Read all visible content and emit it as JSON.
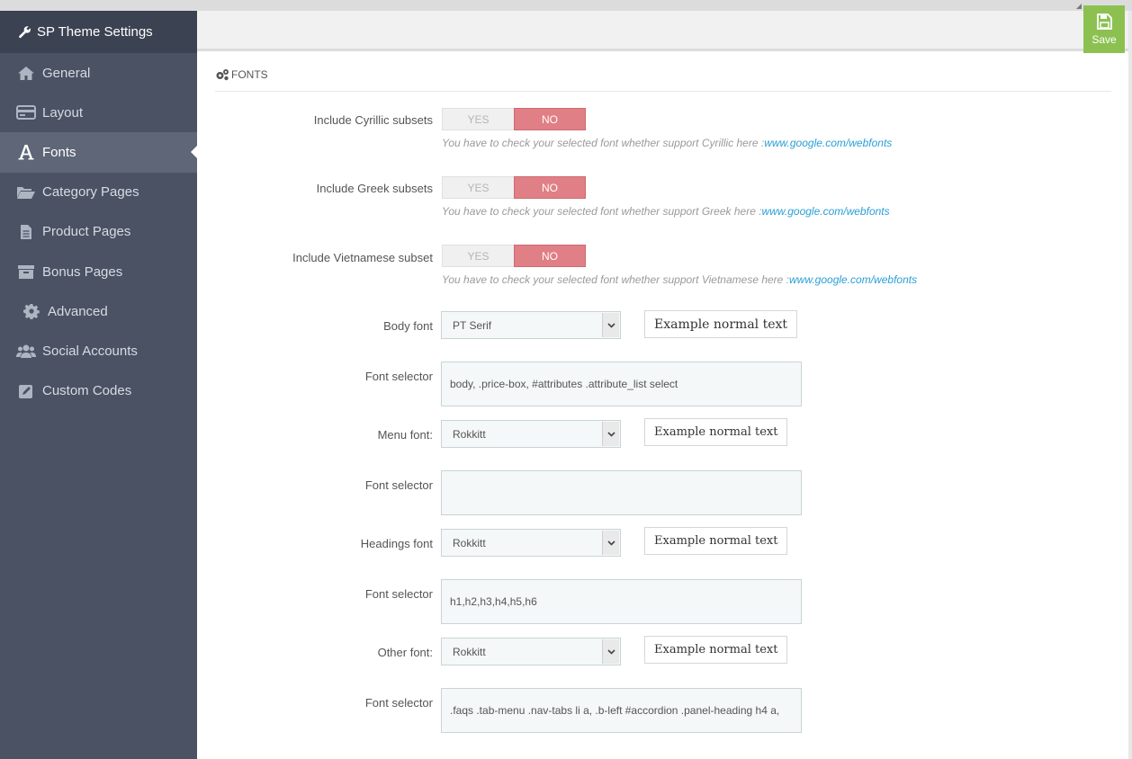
{
  "app": {
    "title": "SP Theme Settings"
  },
  "sidebar": {
    "items": [
      {
        "label": "General",
        "icon": "home-icon"
      },
      {
        "label": "Layout",
        "icon": "credit-card-icon"
      },
      {
        "label": "Fonts",
        "icon": "font-icon",
        "active": true
      },
      {
        "label": "Category Pages",
        "icon": "folder-open-icon"
      },
      {
        "label": "Product Pages",
        "icon": "file-text-icon"
      },
      {
        "label": "Bonus Pages",
        "icon": "archive-icon"
      },
      {
        "label": "Advanced",
        "icon": "gear-icon"
      },
      {
        "label": "Social Accounts",
        "icon": "users-icon"
      },
      {
        "label": "Custom Codes",
        "icon": "edit-icon"
      }
    ]
  },
  "toolbar": {
    "save_label": "Save"
  },
  "section": {
    "title": "FONTS"
  },
  "subsets": [
    {
      "label": "Include Cyrillic subsets",
      "yes": "YES",
      "no": "NO",
      "selected": "NO",
      "help_text": "You have to check your selected font whether support Cyrillic here :",
      "help_link": "www.google.com/webfonts"
    },
    {
      "label": "Include Greek subsets",
      "yes": "YES",
      "no": "NO",
      "selected": "NO",
      "help_text": "You have to check your selected font whether support Greek here :",
      "help_link": "www.google.com/webfonts"
    },
    {
      "label": "Include Vietnamese subset",
      "yes": "YES",
      "no": "NO",
      "selected": "NO",
      "help_text": "You have to check your selected font whether support Vietnamese here :",
      "help_link": "www.google.com/webfonts"
    }
  ],
  "fonts": [
    {
      "label": "Body font",
      "value": "PT Serif",
      "example": "Example normal text",
      "selector_label": "Font selector",
      "selector_value": "body, .price-box, #attributes .attribute_list select"
    },
    {
      "label": "Menu font:",
      "value": "Rokkitt",
      "example": "Example normal text",
      "selector_label": "Font selector",
      "selector_value": ""
    },
    {
      "label": "Headings font",
      "value": "Rokkitt",
      "example": "Example normal text",
      "selector_label": "Font selector",
      "selector_value": "h1,h2,h3,h4,h5,h6"
    },
    {
      "label": "Other font:",
      "value": "Rokkitt",
      "example": "Example normal text",
      "selector_label": "Font selector",
      "selector_value": ".faqs .tab-menu .nav-tabs li a, .b-left #accordion .panel-heading h4 a,"
    }
  ],
  "colors": {
    "sidebar_bg": "#4a5263",
    "sidebar_active": "#5f6677",
    "save_green": "#8cc152",
    "toggle_no": "#e07f85",
    "link_blue": "#2a9fd6"
  }
}
